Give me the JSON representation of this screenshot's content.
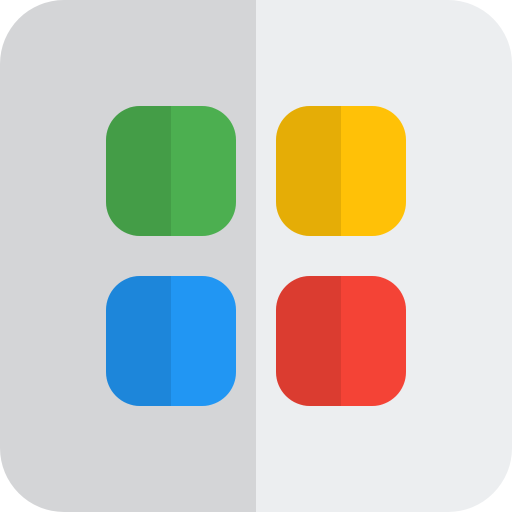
{
  "icon": {
    "name": "app-grid-icon",
    "colors": {
      "background_left": "#d4d5d7",
      "background_right": "#eceef0",
      "tile_top_left": "#4caf50",
      "tile_top_right": "#ffc107",
      "tile_bottom_left": "#2196f3",
      "tile_bottom_right": "#f44336",
      "shade_overlay": "rgba(0,0,0,0.10)"
    },
    "tiles": [
      {
        "name": "tile-top-left-icon",
        "color_key": "tile_top_left"
      },
      {
        "name": "tile-top-right-icon",
        "color_key": "tile_top_right"
      },
      {
        "name": "tile-bottom-left-icon",
        "color_key": "tile_bottom_left"
      },
      {
        "name": "tile-bottom-right-icon",
        "color_key": "tile_bottom_right"
      }
    ]
  }
}
